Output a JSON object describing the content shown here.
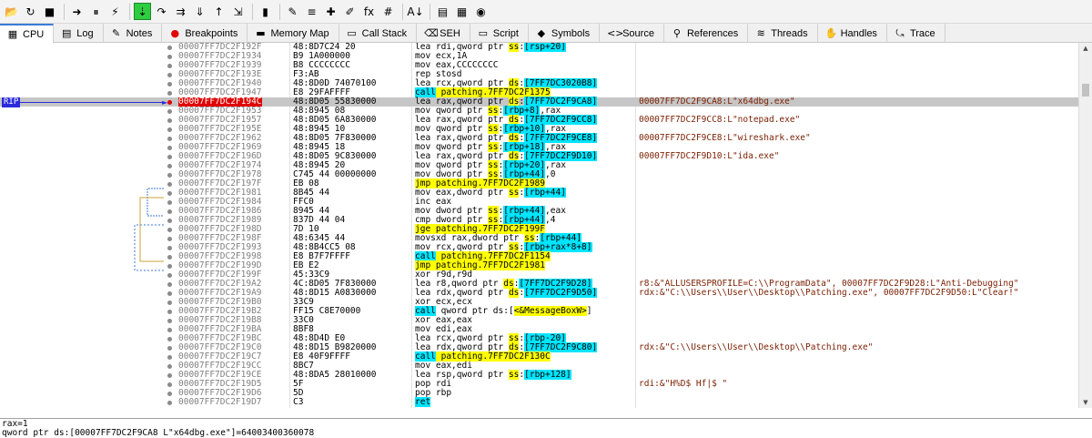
{
  "toolbar": {
    "buttons": [
      {
        "name": "open-icon",
        "glyph": "📂"
      },
      {
        "name": "restart-icon",
        "glyph": "↻"
      },
      {
        "name": "close-icon",
        "glyph": "■"
      },
      {
        "name": "run-icon",
        "glyph": "➜"
      },
      {
        "name": "pause-icon",
        "glyph": "⏸"
      },
      {
        "name": "animate-icon",
        "glyph": "⚡"
      },
      {
        "name": "step-into-icon",
        "glyph": "⇣"
      },
      {
        "name": "step-over-icon",
        "glyph": "↷"
      },
      {
        "name": "trace-into-icon",
        "glyph": "⇉"
      },
      {
        "name": "trace-over-icon",
        "glyph": "⇓"
      },
      {
        "name": "execute-till-return-icon",
        "glyph": "↑"
      },
      {
        "name": "run-to-user-code-icon",
        "glyph": "⇲"
      },
      {
        "name": "scylla-icon",
        "glyph": "▮"
      },
      {
        "name": "patch-icon",
        "glyph": "✎"
      },
      {
        "name": "comment-icon",
        "glyph": "≡"
      },
      {
        "name": "label-icon",
        "glyph": "✚"
      },
      {
        "name": "bookmark-icon",
        "glyph": "✐"
      },
      {
        "name": "function-icon",
        "glyph": "fx"
      },
      {
        "name": "hash-icon",
        "glyph": "#"
      },
      {
        "name": "font-icon",
        "glyph": "A↓"
      },
      {
        "name": "bookmark-list-icon",
        "glyph": "▤"
      },
      {
        "name": "calculator-icon",
        "glyph": "▦"
      },
      {
        "name": "globe-icon",
        "glyph": "◉"
      }
    ],
    "active_index": 6
  },
  "tabs": [
    {
      "label": "CPU",
      "icon": "▦",
      "icon_name": "cpu-icon",
      "active": true
    },
    {
      "label": "Log",
      "icon": "▤",
      "icon_name": "log-icon"
    },
    {
      "label": "Notes",
      "icon": "✎",
      "icon_name": "notes-icon"
    },
    {
      "label": "Breakpoints",
      "icon": "●",
      "icon_name": "breakpoint-icon",
      "icon_color": "#e00000"
    },
    {
      "label": "Memory Map",
      "icon": "▬",
      "icon_name": "memory-map-icon"
    },
    {
      "label": "Call Stack",
      "icon": "▭",
      "icon_name": "call-stack-icon"
    },
    {
      "label": "SEH",
      "icon": "⌫",
      "icon_name": "seh-icon"
    },
    {
      "label": "Script",
      "icon": "▭",
      "icon_name": "script-icon"
    },
    {
      "label": "Symbols",
      "icon": "◆",
      "icon_name": "symbols-icon"
    },
    {
      "label": "Source",
      "icon": "<>",
      "icon_name": "source-icon"
    },
    {
      "label": "References",
      "icon": "⚲",
      "icon_name": "references-icon"
    },
    {
      "label": "Threads",
      "icon": "≋",
      "icon_name": "threads-icon"
    },
    {
      "label": "Handles",
      "icon": "✋",
      "icon_name": "handles-icon"
    },
    {
      "label": "Trace",
      "icon": "⤿",
      "icon_name": "trace-icon"
    }
  ],
  "disasm": {
    "rip_label": "RIP",
    "rows": [
      {
        "addr": "00007FF7DC2F192F",
        "bytes": "48:8D7C24 20",
        "instr": [
          {
            "t": "lea rdi,qword ptr "
          },
          {
            "t": "ss",
            "h": "y"
          },
          {
            "t": ":"
          },
          {
            "t": "[rsp+20]",
            "h": "c"
          }
        ],
        "cmt": ""
      },
      {
        "addr": "00007FF7DC2F1934",
        "bytes": "B9 1A000000",
        "instr": [
          {
            "t": "mov ecx,1A"
          }
        ],
        "cmt": ""
      },
      {
        "addr": "00007FF7DC2F1939",
        "bytes": "B8 CCCCCCCC",
        "instr": [
          {
            "t": "mov eax,CCCCCCCC"
          }
        ],
        "cmt": ""
      },
      {
        "addr": "00007FF7DC2F193E",
        "bytes": "F3:AB",
        "instr": [
          {
            "t": "rep stosd"
          }
        ],
        "cmt": ""
      },
      {
        "addr": "00007FF7DC2F1940",
        "bytes": "48:8D0D 74070100",
        "instr": [
          {
            "t": "lea rcx,qword ptr "
          },
          {
            "t": "ds",
            "h": "y"
          },
          {
            "t": ":"
          },
          {
            "t": "[7FF7DC3020B8]",
            "h": "c"
          }
        ],
        "cmt": ""
      },
      {
        "addr": "00007FF7DC2F1947",
        "bytes": "E8 29FAFFFF",
        "instr": [
          {
            "t": "call",
            "h": "c"
          },
          {
            "t": " patching.7FF7DC2F1375",
            "h": "y"
          }
        ],
        "cmt": ""
      },
      {
        "addr": "00007FF7DC2F194C",
        "bytes": "48:8D05 55830000",
        "instr": [
          {
            "t": "lea rax,qword ptr "
          },
          {
            "t": "ds",
            "h": "y"
          },
          {
            "t": ":"
          },
          {
            "t": "[7FF7DC2F9CA8]",
            "h": "c"
          }
        ],
        "cmt": "00007FF7DC2F9CA8:L\"x64dbg.exe\"",
        "selected": true,
        "breakpoint": true
      },
      {
        "addr": "00007FF7DC2F1953",
        "bytes": "48:8945 08",
        "instr": [
          {
            "t": "mov qword ptr "
          },
          {
            "t": "ss",
            "h": "y"
          },
          {
            "t": ":"
          },
          {
            "t": "[rbp+8]",
            "h": "c"
          },
          {
            "t": ",rax"
          }
        ],
        "cmt": ""
      },
      {
        "addr": "00007FF7DC2F1957",
        "bytes": "48:8D05 6A830000",
        "instr": [
          {
            "t": "lea rax,qword ptr "
          },
          {
            "t": "ds",
            "h": "y"
          },
          {
            "t": ":"
          },
          {
            "t": "[7FF7DC2F9CC8]",
            "h": "c"
          }
        ],
        "cmt": "00007FF7DC2F9CC8:L\"notepad.exe\""
      },
      {
        "addr": "00007FF7DC2F195E",
        "bytes": "48:8945 10",
        "instr": [
          {
            "t": "mov qword ptr "
          },
          {
            "t": "ss",
            "h": "y"
          },
          {
            "t": ":"
          },
          {
            "t": "[rbp+10]",
            "h": "c"
          },
          {
            "t": ",rax"
          }
        ],
        "cmt": ""
      },
      {
        "addr": "00007FF7DC2F1962",
        "bytes": "48:8D05 7F830000",
        "instr": [
          {
            "t": "lea rax,qword ptr "
          },
          {
            "t": "ds",
            "h": "y"
          },
          {
            "t": ":"
          },
          {
            "t": "[7FF7DC2F9CE8]",
            "h": "c"
          }
        ],
        "cmt": "00007FF7DC2F9CE8:L\"wireshark.exe\""
      },
      {
        "addr": "00007FF7DC2F1969",
        "bytes": "48:8945 18",
        "instr": [
          {
            "t": "mov qword ptr "
          },
          {
            "t": "ss",
            "h": "y"
          },
          {
            "t": ":"
          },
          {
            "t": "[rbp+18]",
            "h": "c"
          },
          {
            "t": ",rax"
          }
        ],
        "cmt": ""
      },
      {
        "addr": "00007FF7DC2F196D",
        "bytes": "48:8D05 9C830000",
        "instr": [
          {
            "t": "lea rax,qword ptr "
          },
          {
            "t": "ds",
            "h": "y"
          },
          {
            "t": ":"
          },
          {
            "t": "[7FF7DC2F9D10]",
            "h": "c"
          }
        ],
        "cmt": "00007FF7DC2F9D10:L\"ida.exe\""
      },
      {
        "addr": "00007FF7DC2F1974",
        "bytes": "48:8945 20",
        "instr": [
          {
            "t": "mov qword ptr "
          },
          {
            "t": "ss",
            "h": "y"
          },
          {
            "t": ":"
          },
          {
            "t": "[rbp+20]",
            "h": "c"
          },
          {
            "t": ",rax"
          }
        ],
        "cmt": ""
      },
      {
        "addr": "00007FF7DC2F1978",
        "bytes": "C745 44 00000000",
        "instr": [
          {
            "t": "mov dword ptr "
          },
          {
            "t": "ss",
            "h": "y"
          },
          {
            "t": ":"
          },
          {
            "t": "[rbp+44]",
            "h": "c"
          },
          {
            "t": ",0"
          }
        ],
        "cmt": ""
      },
      {
        "addr": "00007FF7DC2F197F",
        "bytes": "EB 08",
        "instr": [
          {
            "t": "jmp patching.7FF7DC2F1989",
            "h": "y"
          }
        ],
        "cmt": ""
      },
      {
        "addr": "00007FF7DC2F1981",
        "bytes": "8B45 44",
        "instr": [
          {
            "t": "mov eax,dword ptr "
          },
          {
            "t": "ss",
            "h": "y"
          },
          {
            "t": ":"
          },
          {
            "t": "[rbp+44]",
            "h": "c"
          }
        ],
        "cmt": ""
      },
      {
        "addr": "00007FF7DC2F1984",
        "bytes": "FFC0",
        "instr": [
          {
            "t": "inc eax"
          }
        ],
        "cmt": ""
      },
      {
        "addr": "00007FF7DC2F1986",
        "bytes": "8945 44",
        "instr": [
          {
            "t": "mov dword ptr "
          },
          {
            "t": "ss",
            "h": "y"
          },
          {
            "t": ":"
          },
          {
            "t": "[rbp+44]",
            "h": "c"
          },
          {
            "t": ",eax"
          }
        ],
        "cmt": ""
      },
      {
        "addr": "00007FF7DC2F1989",
        "bytes": "837D 44 04",
        "instr": [
          {
            "t": "cmp dword ptr "
          },
          {
            "t": "ss",
            "h": "y"
          },
          {
            "t": ":"
          },
          {
            "t": "[rbp+44]",
            "h": "c"
          },
          {
            "t": ",4"
          }
        ],
        "cmt": ""
      },
      {
        "addr": "00007FF7DC2F198D",
        "bytes": "7D 10",
        "instr": [
          {
            "t": "jge patching.7FF7DC2F199F",
            "h": "y"
          }
        ],
        "cmt": ""
      },
      {
        "addr": "00007FF7DC2F198F",
        "bytes": "48:6345 44",
        "instr": [
          {
            "t": "movsxd rax,dword ptr "
          },
          {
            "t": "ss",
            "h": "y"
          },
          {
            "t": ":"
          },
          {
            "t": "[rbp+44]",
            "h": "c"
          }
        ],
        "cmt": ""
      },
      {
        "addr": "00007FF7DC2F1993",
        "bytes": "48:8B4CC5 08",
        "instr": [
          {
            "t": "mov rcx,qword ptr "
          },
          {
            "t": "ss",
            "h": "y"
          },
          {
            "t": ":"
          },
          {
            "t": "[rbp+rax*8+8]",
            "h": "c"
          }
        ],
        "cmt": ""
      },
      {
        "addr": "00007FF7DC2F1998",
        "bytes": "E8 B7F7FFFF",
        "instr": [
          {
            "t": "call",
            "h": "c"
          },
          {
            "t": " patching.7FF7DC2F1154",
            "h": "y"
          }
        ],
        "cmt": ""
      },
      {
        "addr": "00007FF7DC2F199D",
        "bytes": "EB E2",
        "instr": [
          {
            "t": "jmp patching.7FF7DC2F1981",
            "h": "y"
          }
        ],
        "cmt": ""
      },
      {
        "addr": "00007FF7DC2F199F",
        "bytes": "45:33C9",
        "instr": [
          {
            "t": "xor r9d,r9d"
          }
        ],
        "cmt": ""
      },
      {
        "addr": "00007FF7DC2F19A2",
        "bytes": "4C:8D05 7F830000",
        "instr": [
          {
            "t": "lea r8,qword ptr "
          },
          {
            "t": "ds",
            "h": "y"
          },
          {
            "t": ":"
          },
          {
            "t": "[7FF7DC2F9D28]",
            "h": "c"
          }
        ],
        "cmt": "r8:&\"ALLUSERSPROFILE=C:\\\\ProgramData\", 00007FF7DC2F9D28:L\"Anti-Debugging\""
      },
      {
        "addr": "00007FF7DC2F19A9",
        "bytes": "48:8D15 A0830000",
        "instr": [
          {
            "t": "lea rdx,qword ptr "
          },
          {
            "t": "ds",
            "h": "y"
          },
          {
            "t": ":"
          },
          {
            "t": "[7FF7DC2F9D50]",
            "h": "c"
          }
        ],
        "cmt": "rdx:&\"C:\\\\Users\\\\User\\\\Desktop\\\\Patching.exe\", 00007FF7DC2F9D50:L\"Clear!\""
      },
      {
        "addr": "00007FF7DC2F19B0",
        "bytes": "33C9",
        "instr": [
          {
            "t": "xor ecx,ecx"
          }
        ],
        "cmt": ""
      },
      {
        "addr": "00007FF7DC2F19B2",
        "bytes": "FF15 C8E70000",
        "instr": [
          {
            "t": "call",
            "h": "c"
          },
          {
            "t": " qword ptr ds:["
          },
          {
            "t": "<&MessageBoxW>",
            "h": "y"
          },
          {
            "t": "]"
          }
        ],
        "cmt": ""
      },
      {
        "addr": "00007FF7DC2F19B8",
        "bytes": "33C0",
        "instr": [
          {
            "t": "xor eax,eax"
          }
        ],
        "cmt": ""
      },
      {
        "addr": "00007FF7DC2F19BA",
        "bytes": "8BF8",
        "instr": [
          {
            "t": "mov edi,eax"
          }
        ],
        "cmt": ""
      },
      {
        "addr": "00007FF7DC2F19BC",
        "bytes": "48:8D4D E0",
        "instr": [
          {
            "t": "lea rcx,qword ptr "
          },
          {
            "t": "ss",
            "h": "y"
          },
          {
            "t": ":"
          },
          {
            "t": "[rbp-20]",
            "h": "c"
          }
        ],
        "cmt": ""
      },
      {
        "addr": "00007FF7DC2F19C0",
        "bytes": "48:8D15 B9820000",
        "instr": [
          {
            "t": "lea rdx,qword ptr "
          },
          {
            "t": "ds",
            "h": "y"
          },
          {
            "t": ":"
          },
          {
            "t": "[7FF7DC2F9C80]",
            "h": "c"
          }
        ],
        "cmt": "rdx:&\"C:\\\\Users\\\\User\\\\Desktop\\\\Patching.exe\""
      },
      {
        "addr": "00007FF7DC2F19C7",
        "bytes": "E8 40F9FFFF",
        "instr": [
          {
            "t": "call",
            "h": "c"
          },
          {
            "t": " patching.7FF7DC2F130C",
            "h": "y"
          }
        ],
        "cmt": ""
      },
      {
        "addr": "00007FF7DC2F19CC",
        "bytes": "8BC7",
        "instr": [
          {
            "t": "mov eax,edi"
          }
        ],
        "cmt": ""
      },
      {
        "addr": "00007FF7DC2F19CE",
        "bytes": "48:8DA5 28010000",
        "instr": [
          {
            "t": "lea rsp,qword ptr "
          },
          {
            "t": "ss",
            "h": "y"
          },
          {
            "t": ":"
          },
          {
            "t": "[rbp+128]",
            "h": "c"
          }
        ],
        "cmt": ""
      },
      {
        "addr": "00007FF7DC2F19D5",
        "bytes": "5F",
        "instr": [
          {
            "t": "pop rdi"
          }
        ],
        "cmt": "rdi:&\"H%D$ Hf|$ \""
      },
      {
        "addr": "00007FF7DC2F19D6",
        "bytes": "5D",
        "instr": [
          {
            "t": "pop rbp"
          }
        ],
        "cmt": ""
      },
      {
        "addr": "00007FF7DC2F19D7",
        "bytes": "C3",
        "instr": [
          {
            "t": "ret",
            "h": "c"
          }
        ],
        "cmt": ""
      }
    ]
  },
  "info": {
    "line1": "rax=1",
    "line2": "qword ptr ds:[00007FF7DC2F9CA8 L\"x64dbg.exe\"]=64003400360078"
  },
  "colors": {
    "highlight_yellow": "#ffff00",
    "highlight_cyan": "#00e5ff",
    "rip_blue": "#2b2bdc",
    "breakpoint_red": "#e00000",
    "selected_row": "#c6c6c6",
    "comment_brown": "#7a1f00"
  }
}
